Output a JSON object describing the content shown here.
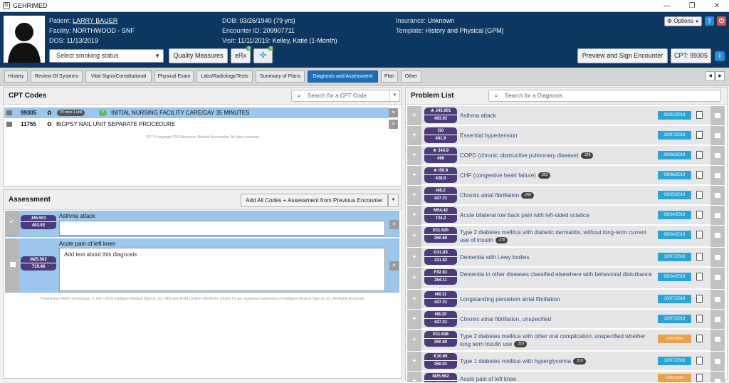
{
  "window": {
    "title": "GEHRIMED",
    "app_icon": "G"
  },
  "patient": {
    "patient_label": "Patient:",
    "patient_name": "LARRY BAUER",
    "facility_label": "Facility:",
    "facility": "NORTHWOOD - SNF",
    "dos_label": "DOS:",
    "dos": "11/13/2019",
    "dob_label": "DOB:",
    "dob": "03/26/1940 (79 yrs)",
    "encounter_label": "Encounter ID:",
    "encounter_id": "209907711",
    "visit_label": "Visit:",
    "visit": "11/11/2019: Kelley, Katie (1-Month)",
    "insurance_label": "Insurance:",
    "insurance": "Unknown",
    "template_label": "Template:",
    "template": "History and Physical [GPM]"
  },
  "toolbar": {
    "smoking_placeholder": "Select smoking status",
    "quality_measures": "Quality Measures",
    "erx": "eRx",
    "options": "Options",
    "preview_sign": "Preview and Sign Encounter",
    "cpt_count": "CPT: 99305"
  },
  "tabs": [
    {
      "label": "History"
    },
    {
      "label": "Review Of Systems"
    },
    {
      "label": "Vital Signs/Constitutional"
    },
    {
      "label": "Physical Exam"
    },
    {
      "label": "Labs/Radiology/Tests"
    },
    {
      "label": "Summary of Plans"
    },
    {
      "label": "Diagnosis and Assessment",
      "active": true
    },
    {
      "label": "Plan"
    },
    {
      "label": "Other"
    }
  ],
  "cpt": {
    "title": "CPT Codes",
    "search_placeholder": "Search for a CPT Code",
    "rows": [
      {
        "code": "99305",
        "time": "20 mins 1 unit",
        "flag": "P",
        "description": "INITIAL NURSING FACILITY CARE/DAY 35 MINUTES"
      },
      {
        "code": "11755",
        "description": "BIOPSY NAIL UNIT SEPARATE PROCEDURE"
      }
    ],
    "copyright": "CPT ® copyright 2019 American Medical Association. All rights reserved."
  },
  "assessment": {
    "title": "Assessment",
    "add_all_button": "Add All Codes + Assessment from Previous Encounter",
    "items": [
      {
        "code": "J45.901",
        "sub": "493.92",
        "name": "Asthma attack",
        "text": ""
      },
      {
        "code": "M25.562",
        "sub": "719.46",
        "name": "Acute pain of left knee",
        "text": "Add text about this diagnosis"
      }
    ],
    "footer": "Powered by IMO® Terminology. © 1997–2015 Intelligent Medical Objects, Inc. IMO and INTELLIGENT MEDICAL OBJECTS are registered trademarks of Intelligent Medical Objects, Inc. All Rights Reserved."
  },
  "problem_list": {
    "title": "Problem List",
    "search_placeholder": "Search for a Diagnosis",
    "items": [
      {
        "code": "J45.901",
        "sub": "493.92",
        "star": true,
        "name": "Asthma attack",
        "tag": "",
        "date": "05/02/2019"
      },
      {
        "code": "I10",
        "sub": "401.9",
        "star": false,
        "name": "Essential hypertension",
        "tag": "",
        "date": "10/07/2019"
      },
      {
        "code": "J44.9",
        "sub": "496",
        "star": true,
        "name": "COPD (chronic obstructive pulmonary disease)",
        "tag": ".328",
        "date": "09/06/2019"
      },
      {
        "code": "I50.9",
        "sub": "428.0",
        "star": true,
        "name": "CHF (congestive heart failure)",
        "tag": ".323",
        "date": "09/06/2019"
      },
      {
        "code": "I48.2",
        "sub": "427.31",
        "star": false,
        "name": "Chronic atrial fibrillation",
        "tag": ".268",
        "date": "09/25/2019"
      },
      {
        "code": "M54.42",
        "sub": "724.2",
        "star": false,
        "name": "Acute bilateral low back pain with left-sided sciatica",
        "tag": "",
        "date": "09/24/2019"
      },
      {
        "code": "E11.620",
        "sub": "250.80",
        "star": false,
        "name": "Type 2 diabetes mellitus with diabetic dermatitis, without long-term current use of insulin",
        "tag": ".318",
        "date": "09/24/2019"
      },
      {
        "code": "G31.83",
        "sub": "331.82",
        "star": false,
        "name": "Dementia with Lewy bodies",
        "tag": "",
        "date": "10/07/2019"
      },
      {
        "code": "F02.81",
        "sub": "294.11",
        "star": false,
        "name": "Dementia in other diseases classified elsewhere with behavioral disturbance",
        "tag": "",
        "date": "09/24/2019"
      },
      {
        "code": "I48.11",
        "sub": "427.31",
        "star": false,
        "name": "Longstanding persistent atrial fibrillation",
        "tag": "",
        "date": "10/07/2019"
      },
      {
        "code": "I48.20",
        "sub": "427.31",
        "star": false,
        "name": "Chronic atrial fibrillation, unspecified",
        "tag": "",
        "date": "10/07/2019"
      },
      {
        "code": "E11.638",
        "sub": "250.80",
        "star": false,
        "name": "Type 2 diabetes mellitus with other oral complication, unspecified whether long term insulin use",
        "tag": ".318",
        "date": "Unknown"
      },
      {
        "code": "E10.65",
        "sub": "250.01",
        "star": false,
        "name": "Type 1 diabetes mellitus with hyperglycemia",
        "tag": ".318",
        "date": "10/07/2019"
      },
      {
        "code": "M25.562",
        "sub": "",
        "star": false,
        "name": "Acute pain of left knee",
        "tag": "",
        "date": "Unknown"
      }
    ]
  },
  "colors": {
    "header_bg": "#0b3760",
    "active_tab": "#1f6fb5",
    "code_pill": "#4b3b7a",
    "date_badge": "#29a4d8",
    "unknown_badge": "#eaa14a",
    "selection": "#9cc7ec"
  }
}
